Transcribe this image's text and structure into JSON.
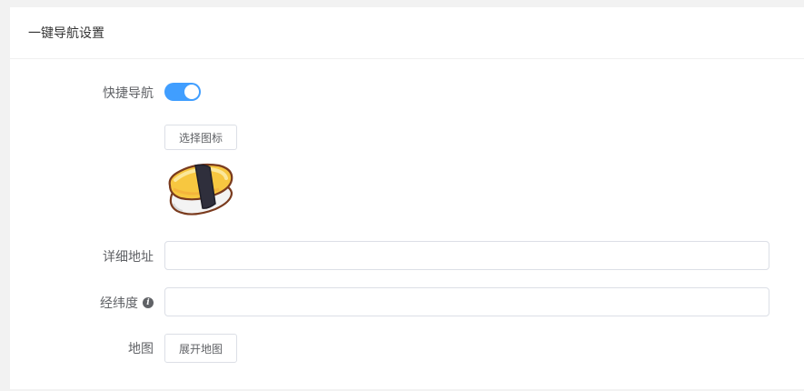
{
  "header": {
    "title": "一键导航设置"
  },
  "form": {
    "quick_nav": {
      "label": "快捷导航",
      "enabled": true
    },
    "icon": {
      "select_button": "选择图标",
      "preview_icon": "sushi-icon"
    },
    "address": {
      "label": "详细地址",
      "value": "",
      "placeholder": ""
    },
    "coordinates": {
      "label": "经纬度",
      "info_icon": "info-icon",
      "value": "",
      "placeholder": ""
    },
    "map": {
      "label": "地图",
      "expand_button": "展开地图"
    }
  },
  "colors": {
    "accent": "#409eff",
    "border": "#dcdfe6",
    "label": "#606266"
  }
}
